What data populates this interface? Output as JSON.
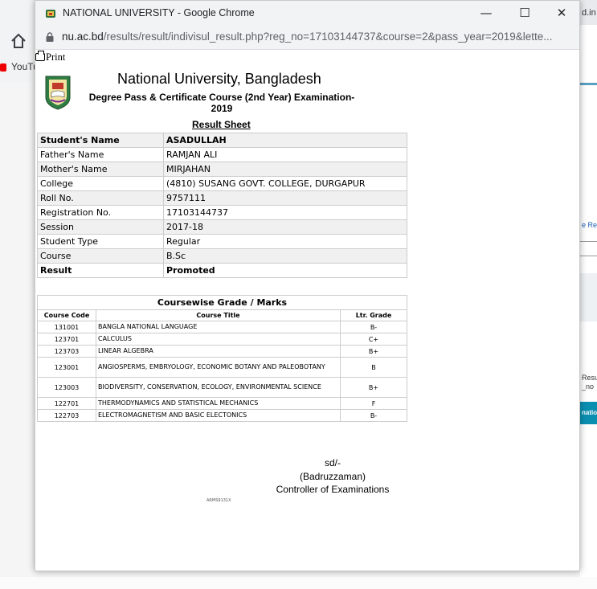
{
  "background": {
    "bookmark_label": "YouTu",
    "right_fragments": [
      "d.in",
      "e Re",
      "Resu",
      "_no",
      "natio"
    ]
  },
  "window": {
    "title": "NATIONAL UNIVERSITY - Google Chrome",
    "minimize": "—",
    "maximize": "☐",
    "close": "✕",
    "url_host": "nu.ac.bd",
    "url_path": "/results/result/indivisul_result.php?reg_no=17103144737&course=2&pass_year=2019&lette..."
  },
  "page": {
    "print_label": "Print",
    "university": "National University, Bangladesh",
    "exam_title": "Degree Pass & Certificate Course (2nd Year) Examination-2019",
    "result_sheet": "Result Sheet",
    "info": [
      {
        "label": "Student's Name",
        "value": "ASADULLAH",
        "bold": true
      },
      {
        "label": "Father's Name",
        "value": "RAMJAN ALI",
        "bold": false
      },
      {
        "label": "Mother's Name",
        "value": "MIRJAHAN",
        "bold": false
      },
      {
        "label": "College",
        "value": "(4810) SUSANG GOVT. COLLEGE, DURGAPUR",
        "bold": false
      },
      {
        "label": "Roll No.",
        "value": "9757111",
        "bold": false
      },
      {
        "label": "Registration No.",
        "value": "17103144737",
        "bold": false
      },
      {
        "label": "Session",
        "value": "2017-18",
        "bold": false
      },
      {
        "label": "Student Type",
        "value": "Regular",
        "bold": false
      },
      {
        "label": "Course",
        "value": "B.Sc",
        "bold": false
      },
      {
        "label": "Result",
        "value": "Promoted",
        "bold": true
      }
    ],
    "grades_caption": "Coursewise Grade / Marks",
    "grade_headers": [
      "Course Code",
      "Course Title",
      "Ltr. Grade"
    ],
    "grades": [
      {
        "code": "131001",
        "title": "BANGLA NATIONAL LANGUAGE",
        "grade": "B-"
      },
      {
        "code": "123701",
        "title": "CALCULUS",
        "grade": "C+"
      },
      {
        "code": "123703",
        "title": "LINEAR ALGEBRA",
        "grade": "B+"
      },
      {
        "code": "123001",
        "title": "ANGIOSPERMS, EMBRYOLOGY, ECONOMIC BOTANY AND PALEOBOTANY",
        "grade": "B"
      },
      {
        "code": "123003",
        "title": "BIODIVERSITY, CONSERVATION, ECOLOGY, ENVIRONMENTAL SCIENCE",
        "grade": "B+"
      },
      {
        "code": "122701",
        "title": "THERMODYNAMICS AND STATISTICAL MECHANICS",
        "grade": "F"
      },
      {
        "code": "122703",
        "title": "ELECTROMAGNETISM AND BASIC ELECTONICS",
        "grade": "B-"
      }
    ],
    "signature": "sd/-",
    "signatory": "(Badruzzaman)",
    "designation": "Controller of Examinations",
    "doc_code": "ARMS9131X"
  }
}
